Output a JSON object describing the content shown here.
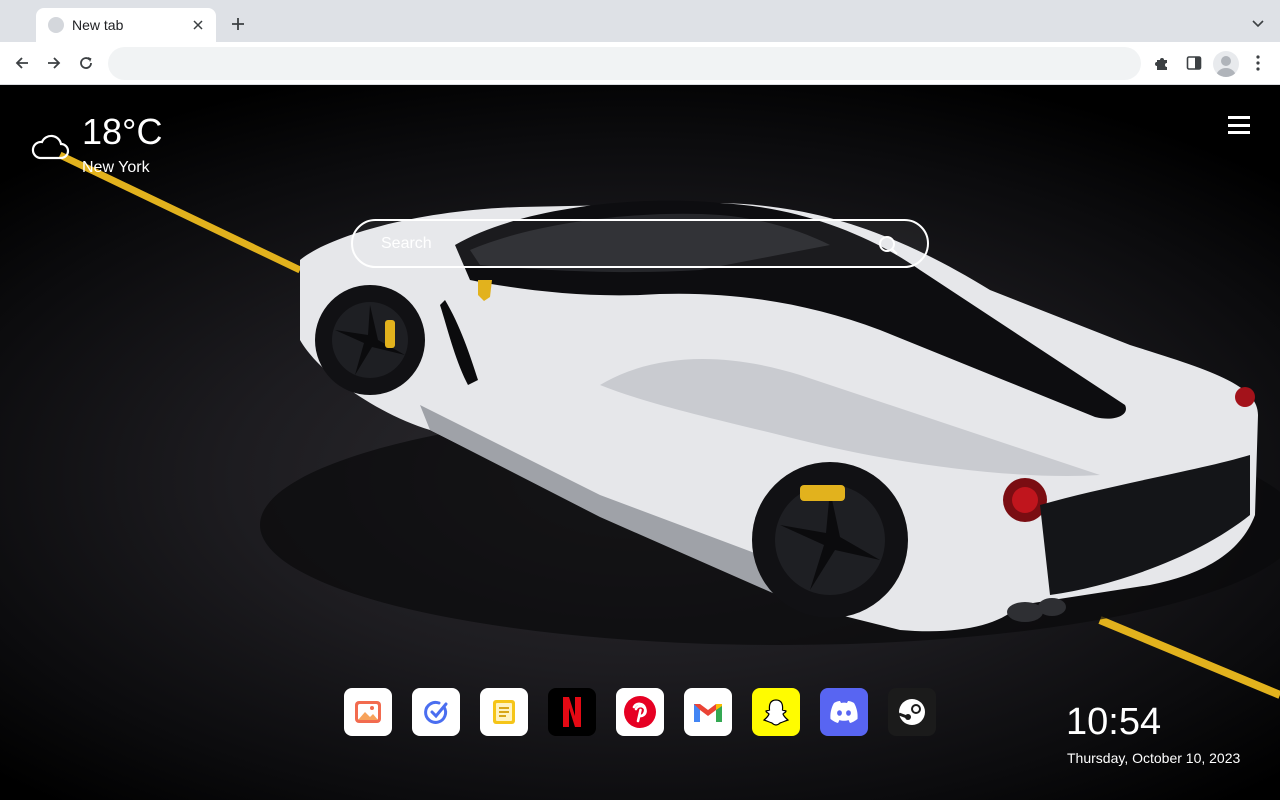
{
  "browser": {
    "tab": {
      "title": "New tab"
    },
    "omnibox": {
      "value": "",
      "placeholder": ""
    }
  },
  "icons": [
    "globe-icon",
    "close-icon",
    "plus-icon",
    "chevron-down-icon",
    "back-arrow-icon",
    "forward-arrow-icon",
    "reload-icon",
    "puzzle-icon",
    "side-panel-icon",
    "profile-icon",
    "kebab-menu-icon",
    "cloud-icon",
    "hamburger-menu-icon",
    "search-icon"
  ],
  "weather": {
    "temperature": "18°C",
    "city": "New York"
  },
  "search": {
    "placeholder": "Search"
  },
  "shortcuts": [
    {
      "name": "photos",
      "icon": "image-icon",
      "bg": "#ffffff"
    },
    {
      "name": "tasks",
      "icon": "check-circle-icon",
      "bg": "#ffffff"
    },
    {
      "name": "notes",
      "icon": "note-icon",
      "bg": "#ffffff"
    },
    {
      "name": "netflix",
      "icon": "netflix-icon",
      "bg": "#000000"
    },
    {
      "name": "pinterest",
      "icon": "pinterest-icon",
      "bg": "#ffffff"
    },
    {
      "name": "gmail",
      "icon": "gmail-icon",
      "bg": "#ffffff"
    },
    {
      "name": "snapchat",
      "icon": "snapchat-icon",
      "bg": "#fffc00"
    },
    {
      "name": "discord",
      "icon": "discord-icon",
      "bg": "#5865f2"
    },
    {
      "name": "steam",
      "icon": "steam-icon",
      "bg": "#1b1b1b"
    }
  ],
  "clock": {
    "time": "10:54",
    "date": "Thursday, October 10, 2023"
  },
  "colors": {
    "accent_yellow": "#e2b21d",
    "car_white": "#e6e7ea",
    "netflix_red": "#e50914",
    "pinterest_red": "#e60023",
    "discord_blurple": "#5865f2"
  }
}
